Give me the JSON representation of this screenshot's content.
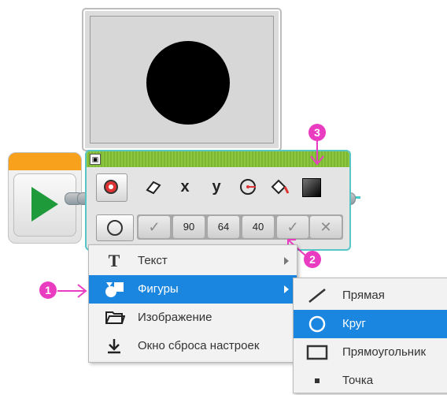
{
  "display_block": {
    "param_icons": [
      "eraser-icon",
      "x",
      "y",
      "radius-icon",
      "fill-icon",
      "color-icon"
    ],
    "values": [
      "✓",
      "90",
      "64",
      "40",
      "✓",
      "✕"
    ]
  },
  "callouts": [
    "1",
    "2",
    "3"
  ],
  "menu": {
    "items": [
      {
        "label": "Текст",
        "icon": "T",
        "has_submenu": true,
        "selected": false
      },
      {
        "label": "Фигуры",
        "icon": "shapes-icon",
        "has_submenu": true,
        "selected": true
      },
      {
        "label": "Изображение",
        "icon": "folder-icon",
        "has_submenu": false,
        "selected": false
      },
      {
        "label": "Окно сброса настроек",
        "icon": "download-icon",
        "has_submenu": false,
        "selected": false
      }
    ]
  },
  "submenu": {
    "items": [
      {
        "label": "Прямая",
        "icon": "line-icon",
        "selected": false
      },
      {
        "label": "Круг",
        "icon": "circle-icon",
        "selected": true
      },
      {
        "label": "Прямоугольник",
        "icon": "rectangle-icon",
        "selected": false
      },
      {
        "label": "Точка",
        "icon": "point-icon",
        "selected": false
      }
    ]
  },
  "colors": {
    "accent": "#1a86e0",
    "callout": "#e93cc0",
    "start_green": "#1f9a3b",
    "block_green": "#8cc63f",
    "block_outline": "#57c5c6"
  }
}
